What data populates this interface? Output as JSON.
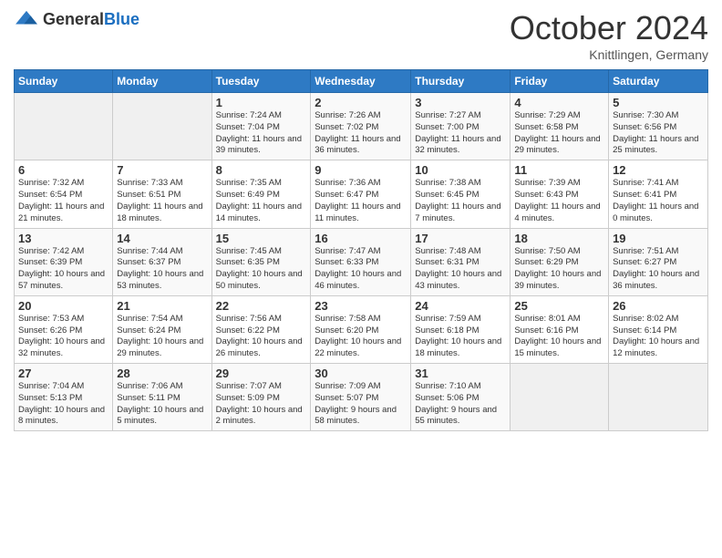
{
  "header": {
    "logo_general": "General",
    "logo_blue": "Blue",
    "title": "October 2024",
    "location": "Knittlingen, Germany"
  },
  "columns": [
    "Sunday",
    "Monday",
    "Tuesday",
    "Wednesday",
    "Thursday",
    "Friday",
    "Saturday"
  ],
  "weeks": [
    [
      {
        "day": "",
        "info": ""
      },
      {
        "day": "",
        "info": ""
      },
      {
        "day": "1",
        "info": "Sunrise: 7:24 AM\nSunset: 7:04 PM\nDaylight: 11 hours and 39 minutes."
      },
      {
        "day": "2",
        "info": "Sunrise: 7:26 AM\nSunset: 7:02 PM\nDaylight: 11 hours and 36 minutes."
      },
      {
        "day": "3",
        "info": "Sunrise: 7:27 AM\nSunset: 7:00 PM\nDaylight: 11 hours and 32 minutes."
      },
      {
        "day": "4",
        "info": "Sunrise: 7:29 AM\nSunset: 6:58 PM\nDaylight: 11 hours and 29 minutes."
      },
      {
        "day": "5",
        "info": "Sunrise: 7:30 AM\nSunset: 6:56 PM\nDaylight: 11 hours and 25 minutes."
      }
    ],
    [
      {
        "day": "6",
        "info": "Sunrise: 7:32 AM\nSunset: 6:54 PM\nDaylight: 11 hours and 21 minutes."
      },
      {
        "day": "7",
        "info": "Sunrise: 7:33 AM\nSunset: 6:51 PM\nDaylight: 11 hours and 18 minutes."
      },
      {
        "day": "8",
        "info": "Sunrise: 7:35 AM\nSunset: 6:49 PM\nDaylight: 11 hours and 14 minutes."
      },
      {
        "day": "9",
        "info": "Sunrise: 7:36 AM\nSunset: 6:47 PM\nDaylight: 11 hours and 11 minutes."
      },
      {
        "day": "10",
        "info": "Sunrise: 7:38 AM\nSunset: 6:45 PM\nDaylight: 11 hours and 7 minutes."
      },
      {
        "day": "11",
        "info": "Sunrise: 7:39 AM\nSunset: 6:43 PM\nDaylight: 11 hours and 4 minutes."
      },
      {
        "day": "12",
        "info": "Sunrise: 7:41 AM\nSunset: 6:41 PM\nDaylight: 11 hours and 0 minutes."
      }
    ],
    [
      {
        "day": "13",
        "info": "Sunrise: 7:42 AM\nSunset: 6:39 PM\nDaylight: 10 hours and 57 minutes."
      },
      {
        "day": "14",
        "info": "Sunrise: 7:44 AM\nSunset: 6:37 PM\nDaylight: 10 hours and 53 minutes."
      },
      {
        "day": "15",
        "info": "Sunrise: 7:45 AM\nSunset: 6:35 PM\nDaylight: 10 hours and 50 minutes."
      },
      {
        "day": "16",
        "info": "Sunrise: 7:47 AM\nSunset: 6:33 PM\nDaylight: 10 hours and 46 minutes."
      },
      {
        "day": "17",
        "info": "Sunrise: 7:48 AM\nSunset: 6:31 PM\nDaylight: 10 hours and 43 minutes."
      },
      {
        "day": "18",
        "info": "Sunrise: 7:50 AM\nSunset: 6:29 PM\nDaylight: 10 hours and 39 minutes."
      },
      {
        "day": "19",
        "info": "Sunrise: 7:51 AM\nSunset: 6:27 PM\nDaylight: 10 hours and 36 minutes."
      }
    ],
    [
      {
        "day": "20",
        "info": "Sunrise: 7:53 AM\nSunset: 6:26 PM\nDaylight: 10 hours and 32 minutes."
      },
      {
        "day": "21",
        "info": "Sunrise: 7:54 AM\nSunset: 6:24 PM\nDaylight: 10 hours and 29 minutes."
      },
      {
        "day": "22",
        "info": "Sunrise: 7:56 AM\nSunset: 6:22 PM\nDaylight: 10 hours and 26 minutes."
      },
      {
        "day": "23",
        "info": "Sunrise: 7:58 AM\nSunset: 6:20 PM\nDaylight: 10 hours and 22 minutes."
      },
      {
        "day": "24",
        "info": "Sunrise: 7:59 AM\nSunset: 6:18 PM\nDaylight: 10 hours and 18 minutes."
      },
      {
        "day": "25",
        "info": "Sunrise: 8:01 AM\nSunset: 6:16 PM\nDaylight: 10 hours and 15 minutes."
      },
      {
        "day": "26",
        "info": "Sunrise: 8:02 AM\nSunset: 6:14 PM\nDaylight: 10 hours and 12 minutes."
      }
    ],
    [
      {
        "day": "27",
        "info": "Sunrise: 7:04 AM\nSunset: 5:13 PM\nDaylight: 10 hours and 8 minutes."
      },
      {
        "day": "28",
        "info": "Sunrise: 7:06 AM\nSunset: 5:11 PM\nDaylight: 10 hours and 5 minutes."
      },
      {
        "day": "29",
        "info": "Sunrise: 7:07 AM\nSunset: 5:09 PM\nDaylight: 10 hours and 2 minutes."
      },
      {
        "day": "30",
        "info": "Sunrise: 7:09 AM\nSunset: 5:07 PM\nDaylight: 9 hours and 58 minutes."
      },
      {
        "day": "31",
        "info": "Sunrise: 7:10 AM\nSunset: 5:06 PM\nDaylight: 9 hours and 55 minutes."
      },
      {
        "day": "",
        "info": ""
      },
      {
        "day": "",
        "info": ""
      }
    ]
  ]
}
